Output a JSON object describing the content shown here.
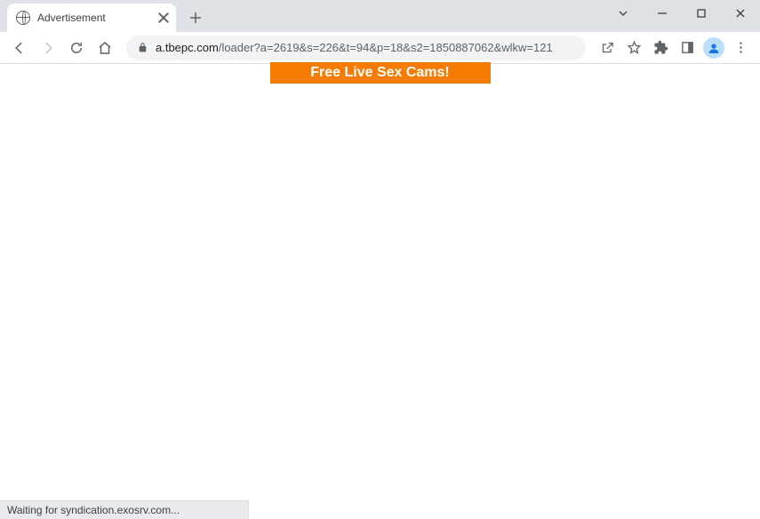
{
  "tab": {
    "title": "Advertisement"
  },
  "url": {
    "domain": "a.tbepc.com",
    "path": "/loader?a=2619&s=226&t=94&p=18&s2=1850887062&wlkw=121"
  },
  "banner": {
    "text": "Free Live Sex Cams!"
  },
  "status": {
    "text": "Waiting for syndication.exosrv.com..."
  }
}
